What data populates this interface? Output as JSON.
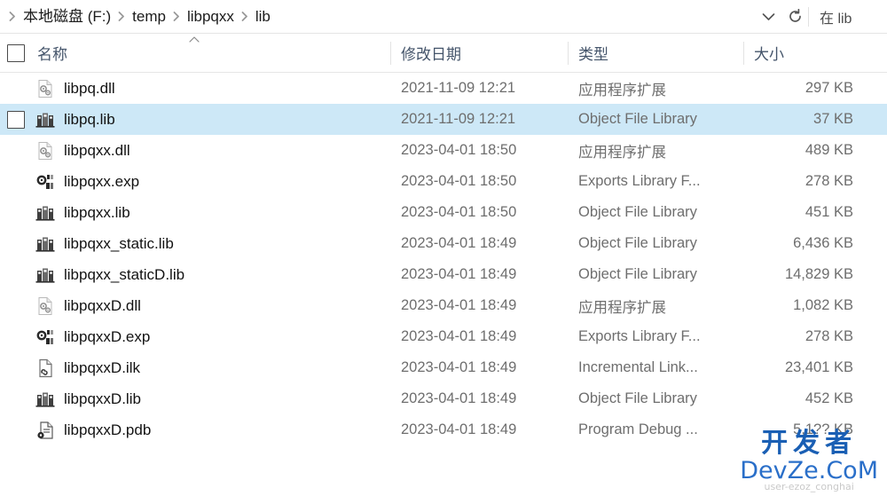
{
  "address_bar": {
    "crumbs": [
      "本地磁盘 (F:)",
      "temp",
      "libpqxx",
      "lib"
    ],
    "history_icon": "chevron-down-icon",
    "refresh_icon": "refresh-icon",
    "search_text": "在 lib"
  },
  "columns": {
    "name": "名称",
    "date_modified": "修改日期",
    "type": "类型",
    "size": "大小",
    "sort_indicator": "^"
  },
  "files": [
    {
      "name": "libpq.dll",
      "icon": "dll-file-icon",
      "date": "2021-11-09 12:21",
      "type": "应用程序扩展",
      "size": "297 KB",
      "selected": false
    },
    {
      "name": "libpq.lib",
      "icon": "lib-file-icon",
      "date": "2021-11-09 12:21",
      "type": "Object File Library",
      "size": "37 KB",
      "selected": true
    },
    {
      "name": "libpqxx.dll",
      "icon": "dll-file-icon",
      "date": "2023-04-01 18:50",
      "type": "应用程序扩展",
      "size": "489 KB",
      "selected": false
    },
    {
      "name": "libpqxx.exp",
      "icon": "exp-file-icon",
      "date": "2023-04-01 18:50",
      "type": "Exports Library F...",
      "size": "278 KB",
      "selected": false
    },
    {
      "name": "libpqxx.lib",
      "icon": "lib-file-icon",
      "date": "2023-04-01 18:50",
      "type": "Object File Library",
      "size": "451 KB",
      "selected": false
    },
    {
      "name": "libpqxx_static.lib",
      "icon": "lib-file-icon",
      "date": "2023-04-01 18:49",
      "type": "Object File Library",
      "size": "6,436 KB",
      "selected": false
    },
    {
      "name": "libpqxx_staticD.lib",
      "icon": "lib-file-icon",
      "date": "2023-04-01 18:49",
      "type": "Object File Library",
      "size": "14,829 KB",
      "selected": false
    },
    {
      "name": "libpqxxD.dll",
      "icon": "dll-file-icon",
      "date": "2023-04-01 18:49",
      "type": "应用程序扩展",
      "size": "1,082 KB",
      "selected": false
    },
    {
      "name": "libpqxxD.exp",
      "icon": "exp-file-icon",
      "date": "2023-04-01 18:49",
      "type": "Exports Library F...",
      "size": "278 KB",
      "selected": false
    },
    {
      "name": "libpqxxD.ilk",
      "icon": "ilk-file-icon",
      "date": "2023-04-01 18:49",
      "type": "Incremental Link...",
      "size": "23,401 KB",
      "selected": false
    },
    {
      "name": "libpqxxD.lib",
      "icon": "lib-file-icon",
      "date": "2023-04-01 18:49",
      "type": "Object File Library",
      "size": "452 KB",
      "selected": false
    },
    {
      "name": "libpqxxD.pdb",
      "icon": "pdb-file-icon",
      "date": "2023-04-01 18:49",
      "type": "Program Debug ...",
      "size": "5,1?? KB",
      "selected": false
    }
  ],
  "watermark": {
    "cn": "开发者",
    "en": "DevZe.CoM",
    "sub": "user-ezoz_conghai"
  },
  "colors": {
    "selection": "#cde8f7",
    "header_text": "#44546a",
    "body_text": "#121212",
    "secondary_text": "#6e6e6e",
    "watermark_blue": "#1a5fb4"
  }
}
